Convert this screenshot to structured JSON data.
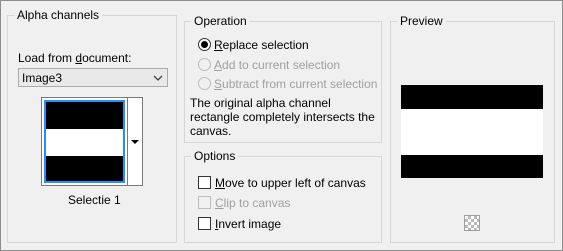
{
  "alpha_group": {
    "title": "Alpha channels",
    "load_label_pre": "Load from ",
    "load_label_ul": "d",
    "load_label_post": "ocument:",
    "document_select_value": "Image3",
    "thumbnail_caption": "Selectie 1"
  },
  "operation_group": {
    "title": "Operation",
    "options": [
      {
        "ul": "R",
        "rest": "eplace selection",
        "checked": true,
        "enabled": true
      },
      {
        "ul": "A",
        "rest": "dd to current selection",
        "checked": false,
        "enabled": false
      },
      {
        "ul": "S",
        "rest": "ubtract from current selection",
        "checked": false,
        "enabled": false
      }
    ],
    "info_line1": "The original alpha channel",
    "info_line2": "rectangle completely intersects the",
    "info_line3": "canvas."
  },
  "options_group": {
    "title": "Options",
    "move_ul": "M",
    "move_rest": "ove to upper left of canvas",
    "clip_ul": "C",
    "clip_rest": "lip to canvas",
    "invert_ul": "I",
    "invert_rest": "nvert image",
    "move_checked": false,
    "clip_checked": false,
    "invert_checked": false
  },
  "preview_group": {
    "title": "Preview"
  },
  "icons": {
    "select_arrow": "chevron-down-icon",
    "thumb_dropdown": "triangle-down-icon",
    "transparency": "checkerboard-icon"
  }
}
